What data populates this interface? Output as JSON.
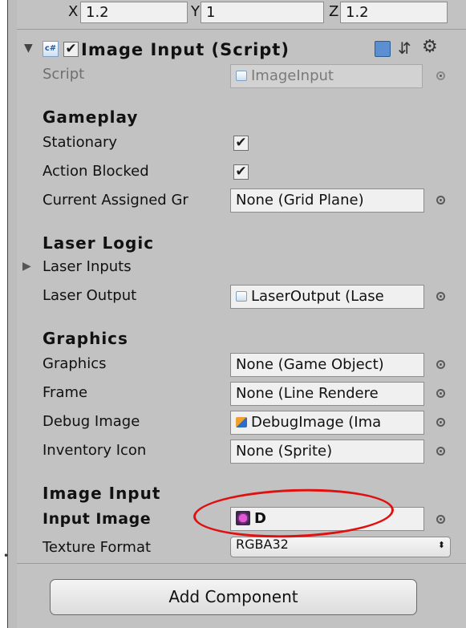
{
  "transform": {
    "scale_x_label": "X",
    "scale_x": "1.2",
    "scale_y_label": "Y",
    "scale_y": "1",
    "scale_z_label": "Z",
    "scale_z": "1.2"
  },
  "component": {
    "title": "Image Input (Script)",
    "script_label": "Script",
    "script_value": "ImageInput"
  },
  "sections": {
    "gameplay": {
      "header": "Gameplay",
      "stationary_label": "Stationary",
      "action_blocked_label": "Action Blocked",
      "current_grid_label": "Current Assigned Gr",
      "current_grid_value": "None (Grid Plane)"
    },
    "laser": {
      "header": "Laser Logic",
      "inputs_label": "Laser Inputs",
      "output_label": "Laser Output",
      "output_value": "LaserOutput (Lase"
    },
    "graphics": {
      "header": "Graphics",
      "graphics_label": "Graphics",
      "graphics_value": "None (Game Object)",
      "frame_label": "Frame",
      "frame_value": "None (Line Rendere",
      "debug_label": "Debug Image",
      "debug_value": "DebugImage (Ima",
      "inventory_label": "Inventory Icon",
      "inventory_value": "None (Sprite)"
    },
    "image_input": {
      "header": "Image Input",
      "input_image_label": "Input Image",
      "input_image_value": "D",
      "texture_format_label": "Texture Format",
      "texture_format_value": "RGBA32"
    }
  },
  "checked": {
    "stationary": "✔",
    "action_blocked": "✔"
  },
  "add_component_label": "Add Component",
  "colors": {
    "panel": "#c2c2c2",
    "annotation": "#e01010"
  }
}
